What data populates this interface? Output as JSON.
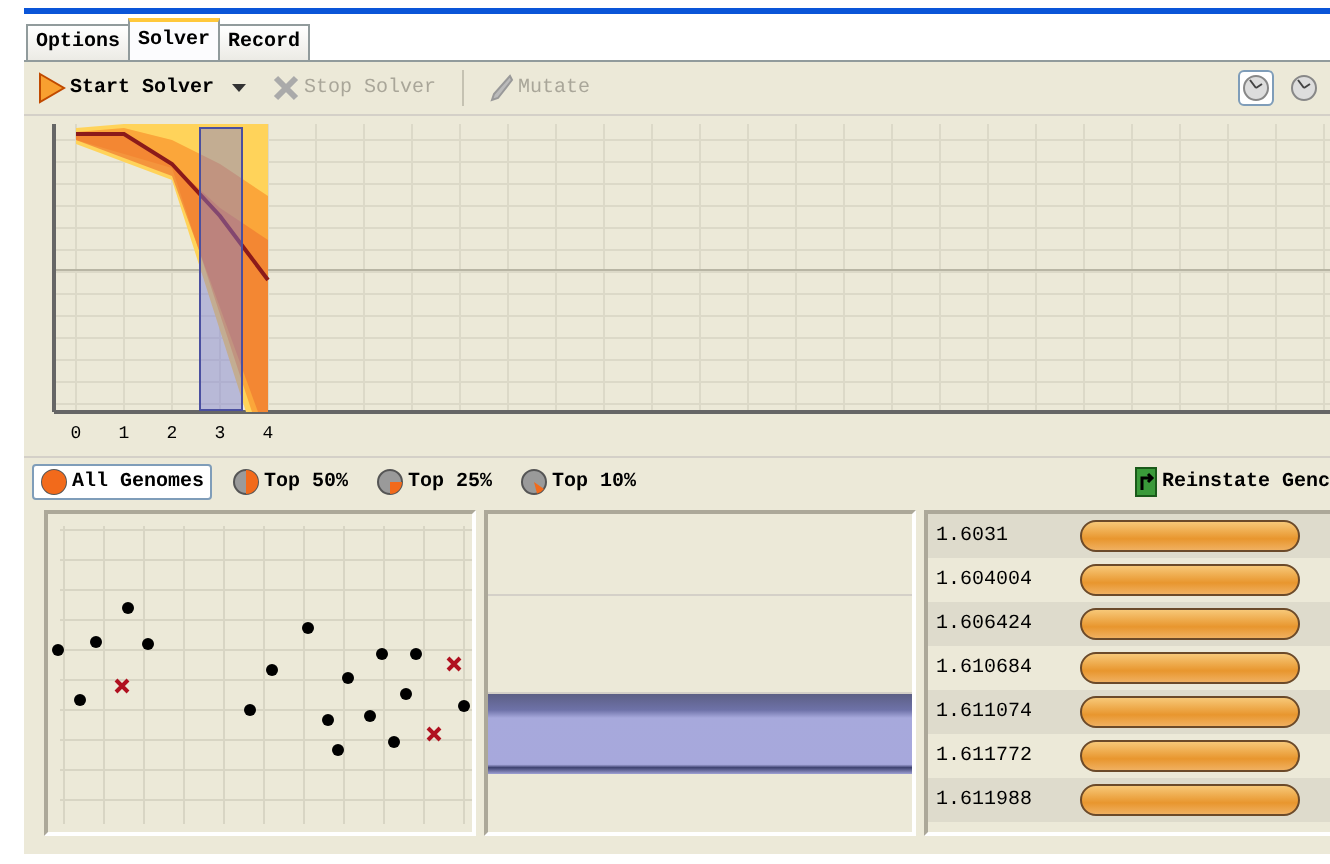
{
  "tabs": [
    {
      "label": "Options",
      "selected": false
    },
    {
      "label": "Solver",
      "selected": true
    },
    {
      "label": "Record",
      "selected": false
    }
  ],
  "toolbar": {
    "items": [
      {
        "kind": "start",
        "label": "Start Solver",
        "disabled": false,
        "dropdown": true
      },
      {
        "kind": "stop",
        "label": "Stop Solver",
        "disabled": true,
        "dropdown": false
      },
      {
        "kind": "mutate",
        "label": "Mutate",
        "disabled": true,
        "dropdown": false
      }
    ],
    "view_toggles": [
      {
        "selected": true
      },
      {
        "selected": false
      }
    ]
  },
  "progress_chart": {
    "axis_labels": [
      "0",
      "1",
      "2",
      "3",
      "4"
    ]
  },
  "filters": [
    {
      "kind": "all",
      "label": "All Genomes",
      "selected": true
    },
    {
      "kind": "half",
      "label": "Top 50%",
      "selected": false
    },
    {
      "kind": "quarter",
      "label": "Top 25%",
      "selected": false
    },
    {
      "kind": "tenth",
      "label": "Top 10%",
      "selected": false
    }
  ],
  "reinstate_button": {
    "label": "Reinstate Genc"
  },
  "genome_list": [
    {
      "fitness": "1.6031"
    },
    {
      "fitness": "1.604004"
    },
    {
      "fitness": "1.606424"
    },
    {
      "fitness": "1.610684"
    },
    {
      "fitness": "1.611074"
    },
    {
      "fitness": "1.611772"
    },
    {
      "fitness": "1.611988"
    }
  ]
}
